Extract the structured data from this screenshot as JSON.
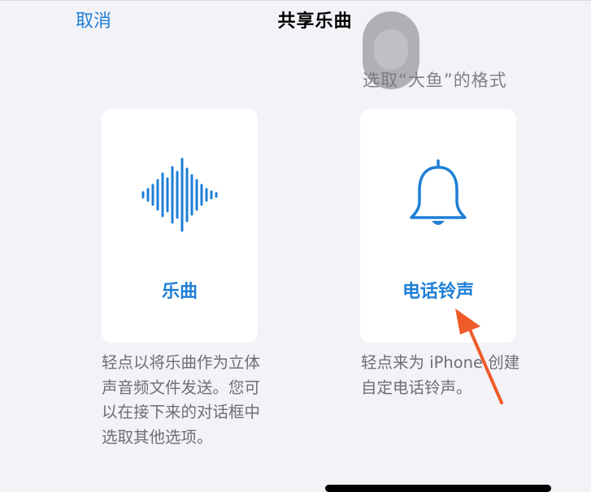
{
  "header": {
    "cancel_label": "取消",
    "title": "共享乐曲",
    "subtitle": "选取“大鱼”的格式"
  },
  "options": [
    {
      "label": "乐曲",
      "icon": "waveform-icon",
      "description": "轻点以将乐曲作为立体声音频文件发送。您可以在接下来的对话框中选取其他选项。"
    },
    {
      "label": "电话铃声",
      "icon": "bell-icon",
      "description": "轻点来为 iPhone 创建自定电话铃声。"
    }
  ],
  "colors": {
    "accent": "#1f7fd6",
    "background": "#f2f2f7",
    "secondary_text": "#6e6e73",
    "annotation_arrow": "#ee5a28"
  }
}
